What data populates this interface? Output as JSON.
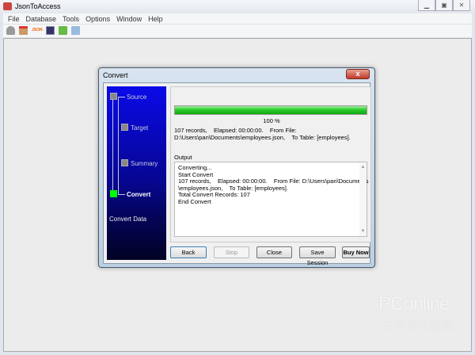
{
  "window": {
    "title": "JsonToAccess",
    "controls": [
      "minimize",
      "restore",
      "close"
    ]
  },
  "menu": [
    "File",
    "Database",
    "Tools",
    "Options",
    "Window",
    "Help"
  ],
  "toolbar": [
    "connect-icon",
    "export-icon",
    "json-icon",
    "convert-icon",
    "refresh-icon",
    "table-icon"
  ],
  "dialog": {
    "title": "Convert",
    "steps": [
      {
        "label": "Source",
        "state": "done"
      },
      {
        "label": "Target",
        "state": "done"
      },
      {
        "label": "Summary",
        "state": "done"
      },
      {
        "label": "Convert",
        "state": "active"
      }
    ],
    "section_label": "Convert Data",
    "progress": {
      "percent": 100,
      "label": "100 %"
    },
    "info_line1": "107 records,    Elapsed: 00:00:00.    From File:",
    "info_line2": "D:\\Users\\pan\\Documents\\employees.json,    To Table: [employees].",
    "output_label": "Output",
    "output_lines": [
      "Converting...",
      "Start Convert",
      "107 records,    Elapsed: 00:00:00.    From File: D:\\Users\\pan\\Documents",
      "\\employees.json,    To Table: [employees].",
      "Total Convert Records: 107",
      "End Convert"
    ],
    "buttons": {
      "back": "Back",
      "stop": "Stop",
      "close": "Close",
      "save": "Save Session",
      "buy": "Buy Now"
    }
  },
  "watermark": {
    "line1": "PConline",
    "line2": "太平洋电脑网"
  },
  "colors": {
    "progress": "#2bcc2b",
    "active_step": "#00ff00",
    "step_panel": "#0a0ae8"
  }
}
